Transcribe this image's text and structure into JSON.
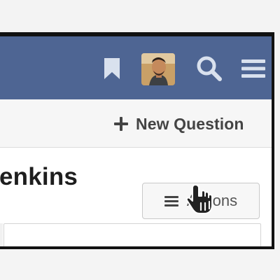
{
  "header": {
    "icons": {
      "bookmark": "bookmark-icon",
      "avatar": "user-avatar",
      "search": "search-icon",
      "menu": "menu-icon"
    },
    "accent_color": "#4e6593"
  },
  "subbar": {
    "new_question_label": "New Question"
  },
  "content": {
    "title": "enkins",
    "actions_label": "Actions"
  }
}
